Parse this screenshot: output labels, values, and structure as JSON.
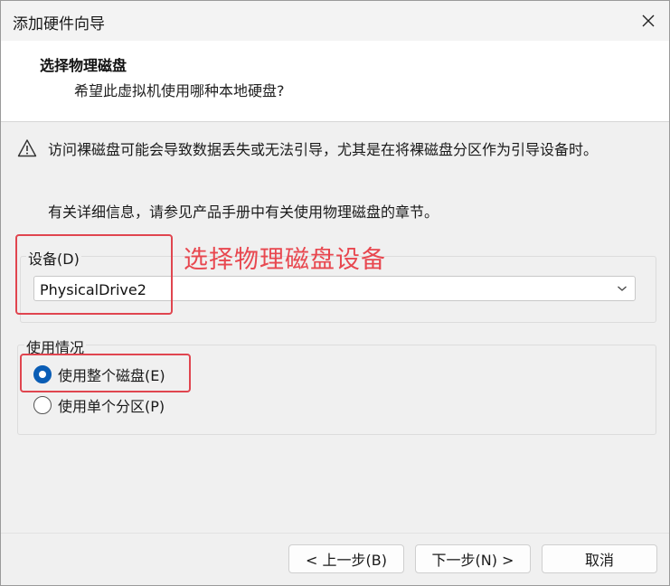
{
  "window": {
    "title": "添加硬件向导"
  },
  "header": {
    "title": "选择物理磁盘",
    "subtitle": "希望此虚拟机使用哪种本地硬盘?"
  },
  "warning": {
    "text": "访问裸磁盘可能会导致数据丢失或无法引导，尤其是在将裸磁盘分区作为引导设备时。",
    "icon": "warning-triangle-icon"
  },
  "info": {
    "text": "有关详细信息，请参见产品手册中有关使用物理磁盘的章节。"
  },
  "device": {
    "label": "设备(D)",
    "selected": "PhysicalDrive2"
  },
  "usage": {
    "label": "使用情况",
    "options": [
      {
        "label": "使用整个磁盘(E)",
        "checked": true
      },
      {
        "label": "使用单个分区(P)",
        "checked": false
      }
    ]
  },
  "annotation": {
    "text": "选择物理磁盘设备",
    "color": "#e8474f"
  },
  "buttons": {
    "back": "< 上一步(B)",
    "next": "下一步(N) >",
    "cancel": "取消"
  },
  "colors": {
    "accent": "#0a5db5",
    "annotation": "#e0454f"
  }
}
